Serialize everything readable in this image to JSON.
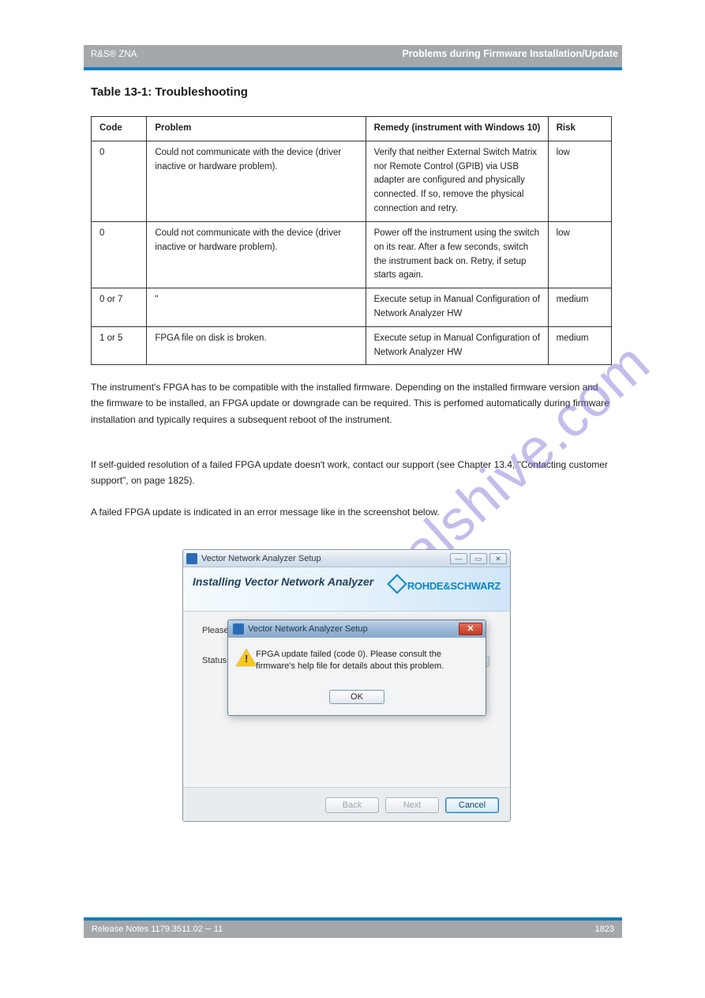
{
  "header": {
    "left": "R&S® ZNA",
    "right": "Problems during Firmware Installation/Update"
  },
  "section_heading": "Table 13-1: Troubleshooting",
  "table": {
    "headers": [
      "Code",
      "Problem",
      "Remedy (instrument with Windows 10)",
      "Risk"
    ],
    "rows": [
      {
        "c1": "0",
        "c2": "Could not communicate with the device (driver inactive or hardware prob­lem).",
        "c3": "Verify that neither External Switch Matrix nor Remote Control (GPIB) via USB adapter are configured and physically connected. If so, remove the physical connection and retry.",
        "c4": "low"
      },
      {
        "c1": "0",
        "c2": "Could not communicate with the device (driver inactive or hardware prob­lem).",
        "c3": "Power off the instrument using the switch on its rear. After a few seconds, switch the instru­ment back on. Retry, if setup starts again.",
        "c4": "low"
      },
      {
        "c1": "0 or 7",
        "c2": "\"",
        "c3": "Execute setup in Manual Configuration of Network Analyzer HW",
        "c4": "medium"
      },
      {
        "c1": "1 or 5",
        "c2": "FPGA file on disk is broken.",
        "c3": "Execute setup in Manual Configuration of Network Analyzer HW",
        "c4": "medium"
      }
    ]
  },
  "body": {
    "p1": "The instrument's FPGA has to be compatible with the installed firmware. Depending on the installed firmware version and the firmware to be installed, an FPGA update or downgrade can be required. This is perfomed automatically during firmware instal­lation and typically requires a subsequent reboot of the instrument.",
    "p2": "If self-guided resolution of a failed FPGA update doesn't work, contact our support (see Chapter 13.4, \"Contacting customer support\", on page 1825).",
    "p3": "A failed FPGA update is indicated in an error message like in the screenshot below."
  },
  "outer_window": {
    "title": "Vector Network Analyzer Setup",
    "banner_title": "Installing Vector Network Analyzer",
    "brand": "ROHDE&SCHWARZ",
    "please": "Please w",
    "status_label": "Status:",
    "buttons": {
      "back": "Back",
      "next": "Next",
      "cancel": "Cancel"
    }
  },
  "msgbox": {
    "title": "Vector Network Analyzer Setup",
    "text": "FPGA update failed (code 0). Please consult the firmware's help file for details about this problem.",
    "ok": "OK"
  },
  "footer": {
    "left": "Release Notes 1179.3511.02 ─ 11",
    "center": "",
    "right": "1823"
  },
  "watermark": "manualshive.com"
}
